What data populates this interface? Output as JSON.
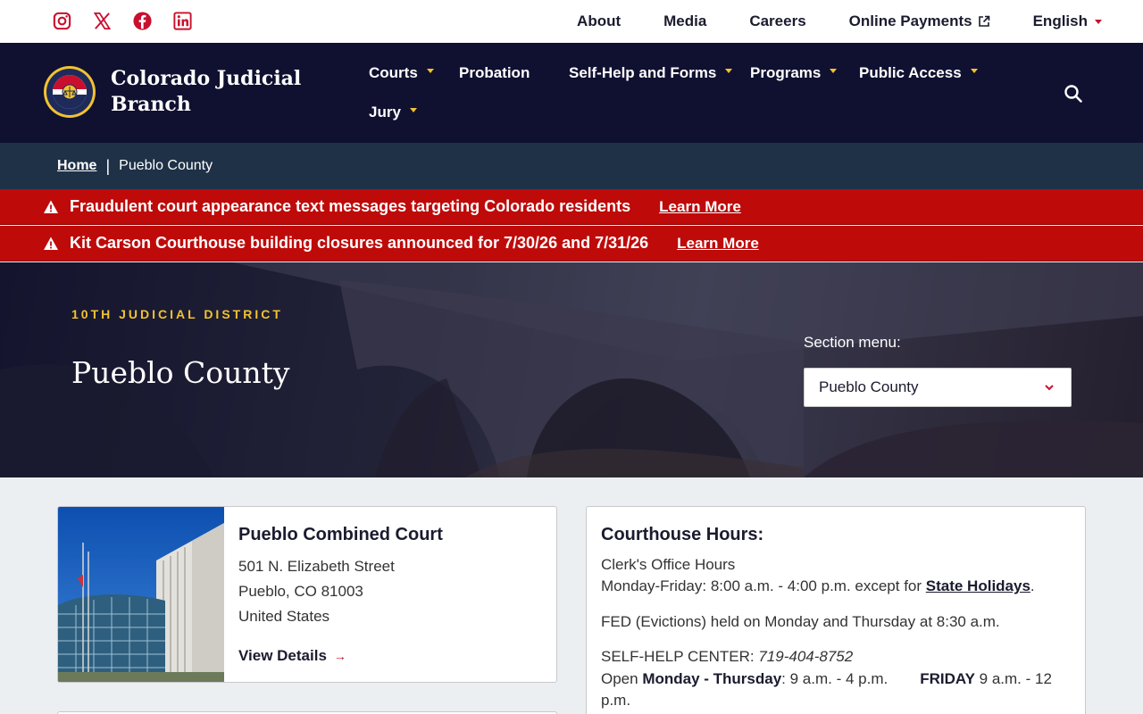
{
  "utility": {
    "social": [
      "instagram-icon",
      "x-icon",
      "facebook-icon",
      "linkedin-icon"
    ],
    "links": [
      "About",
      "Media",
      "Careers",
      "Online Payments"
    ],
    "language": "English"
  },
  "header": {
    "brand": "Colorado Judicial Branch",
    "nav": [
      "Courts",
      "Probation",
      "Self-Help and Forms",
      "Programs",
      "Public Access",
      "Jury"
    ]
  },
  "breadcrumb": {
    "home": "Home",
    "current": "Pueblo County"
  },
  "alerts": [
    {
      "text": "Fraudulent court appearance text messages targeting Colorado residents",
      "link": "Learn More"
    },
    {
      "text": "Kit Carson Courthouse building closures announced for 7/30/26 and 7/31/26",
      "link": "Learn More"
    }
  ],
  "hero": {
    "district": "10TH JUDICIAL DISTRICT",
    "title": "Pueblo County",
    "section_label": "Section menu:",
    "section_value": "Pueblo County"
  },
  "court": {
    "name": "Pueblo Combined Court",
    "street": "501 N. Elizabeth Street",
    "city": "Pueblo, CO 81003",
    "country": "United States",
    "link": "View Details"
  },
  "hours": {
    "title": "Courthouse Hours:",
    "clerk": "Clerk's Office Hours",
    "weekday_prefix": "Monday-Friday: 8:00 a.m. - 4:00 p.m. except for ",
    "holidays_link": "State Holidays",
    "weekday_suffix": ".",
    "fed": "FED (Evictions) held on Monday and Thursday at 8:30 a.m.",
    "selfhelp_label": "SELF-HELP CENTER: ",
    "selfhelp_phone": "719-404-8752",
    "open_prefix": "Open ",
    "open_days": "Monday - Thursday",
    "open_times": ":  9 a.m. - 4 p.m.",
    "friday_label": "FRIDAY",
    "friday_times": " 9 a.m. - 12",
    "friday_end": "p.m."
  },
  "colors": {
    "navy": "#101031",
    "breadcrumb_bg": "#1e3147",
    "alert_red": "#bf0a0a",
    "accent_gold": "#f2c230",
    "accent_red": "#c8102e"
  }
}
